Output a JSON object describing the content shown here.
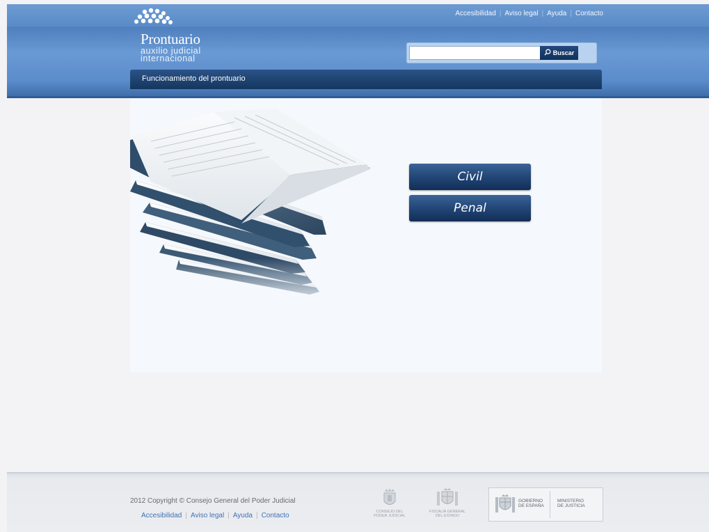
{
  "header": {
    "logo_title": "Prontuario",
    "logo_sub_1": "auxilio judicial",
    "logo_sub_2": "internacional",
    "top_links": [
      "Accesibilidad",
      "Aviso legal",
      "Ayuda",
      "Contacto"
    ],
    "search_value": "",
    "search_button": "Buscar"
  },
  "nav": {
    "item": "Funcionamiento del prontuario"
  },
  "main": {
    "buttons": [
      "Civil",
      "Penal"
    ]
  },
  "footer": {
    "copyright": "2012 Copyright © Consejo General del Poder Judicial",
    "links": [
      "Accesibilidad",
      "Aviso legal",
      "Ayuda",
      "Contacto"
    ],
    "seal_1": [
      "CONSEJO DEL",
      "PODER JUDICIAL"
    ],
    "seal_2": [
      "FISCALÍA GENERAL",
      "DEL ESTADO"
    ],
    "gov_1": [
      "GOBIERNO",
      "DE ESPAÑA"
    ],
    "gov_2": [
      "MINISTERIO",
      "DE JUSTICIA"
    ]
  },
  "colors": {
    "brand_blue": "#5a8bc8",
    "nav_dark": "#14375f",
    "button_dark": "#122e57",
    "page_bg": "#f3f2f4"
  }
}
